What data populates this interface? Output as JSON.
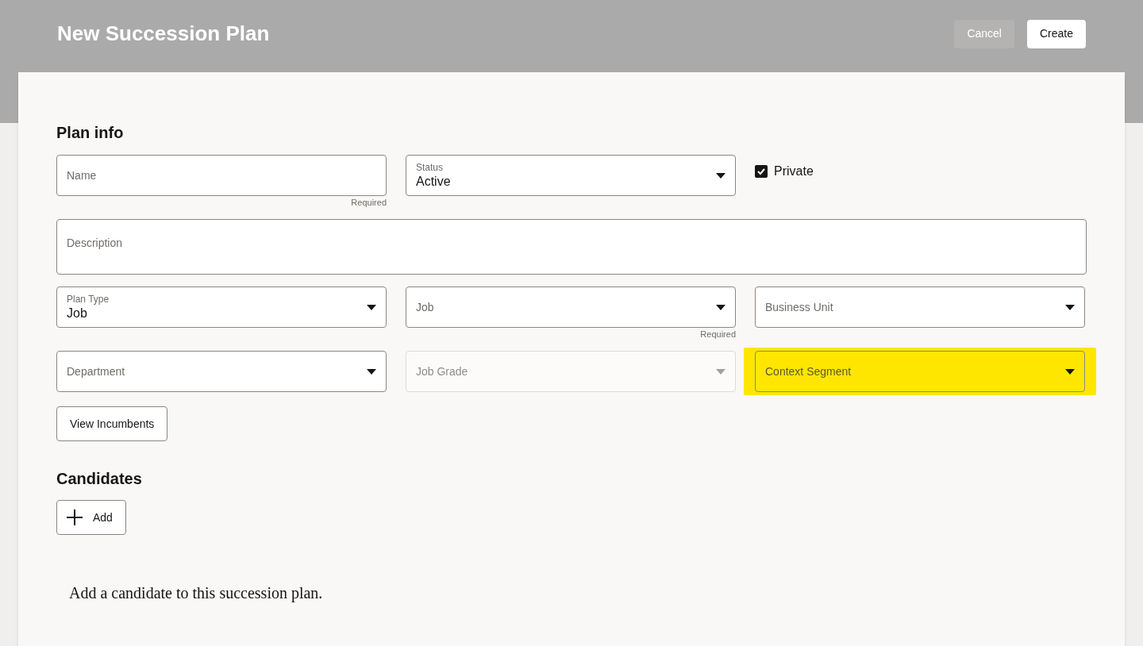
{
  "header": {
    "title": "New Succession Plan",
    "buttons": [
      {
        "label": "Cancel",
        "kind": "secondary"
      },
      {
        "label": "Create",
        "kind": "primary"
      }
    ]
  },
  "plan_info": {
    "heading": "Plan info",
    "rows": [
      [
        {
          "kind": "text",
          "label": "Name",
          "helper": "Required"
        },
        {
          "kind": "select",
          "label": "Status",
          "value": "Active"
        },
        {
          "kind": "checkbox",
          "label": "Private",
          "checked": true
        }
      ],
      [
        {
          "kind": "textarea",
          "label": "Description"
        }
      ],
      [
        {
          "kind": "select",
          "label": "Plan Type",
          "value": "Job"
        },
        {
          "kind": "select",
          "label": "Job",
          "helper": "Required"
        },
        {
          "kind": "select",
          "label": "Business Unit"
        }
      ],
      [
        {
          "kind": "select",
          "label": "Department"
        },
        {
          "kind": "select",
          "label": "Job Grade",
          "disabled": true
        },
        {
          "kind": "select",
          "label": "Context Segment",
          "highlighted": true
        }
      ]
    ],
    "button": "View Incumbents"
  },
  "candidates": {
    "heading": "Candidates",
    "add_button": "Add",
    "empty_message": "Add a candidate to this succession plan."
  }
}
